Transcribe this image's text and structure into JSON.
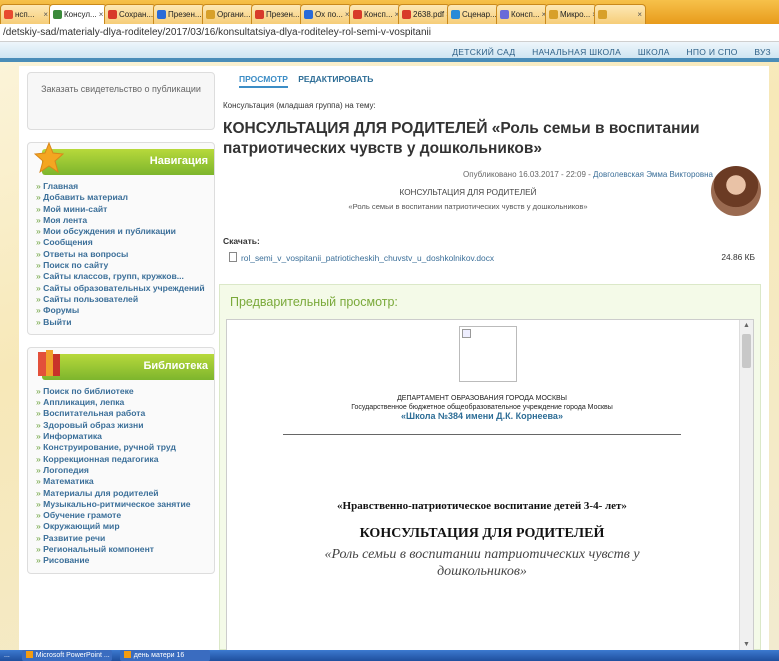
{
  "browser": {
    "tabs": [
      {
        "label": "нсп...",
        "color": "#e84a2f",
        "active": false
      },
      {
        "label": "Консул...",
        "color": "#3a8a3a",
        "active": true
      },
      {
        "label": "Сохран...",
        "color": "#d83a2a",
        "active": false
      },
      {
        "label": "Презен...",
        "color": "#2a6ad8",
        "active": false
      },
      {
        "label": "Органи...",
        "color": "#d8a02a",
        "active": false
      },
      {
        "label": "Презен...",
        "color": "#d83a2a",
        "active": false
      },
      {
        "label": "Ох по...",
        "color": "#2a6ad8",
        "active": false
      },
      {
        "label": "Консп...",
        "color": "#d83a2a",
        "active": false
      },
      {
        "label": "2638.pdf",
        "color": "#d83a2a",
        "active": false
      },
      {
        "label": "Сценар...",
        "color": "#2a8ad8",
        "active": false
      },
      {
        "label": "Консп...",
        "color": "#6a6ad8",
        "active": false
      },
      {
        "label": "Микро...",
        "color": "#d8a02a",
        "active": false
      },
      {
        "label": "",
        "color": "#d8a02a",
        "active": false
      }
    ],
    "address": "/detskiy-sad/materialy-dlya-roditeley/2017/03/16/konsultatsiya-dlya-roditeley-rol-semi-v-vospitanii"
  },
  "topnav": {
    "items": [
      "ДЕТСКИЙ САД",
      "НАЧАЛЬНАЯ ШКОЛА",
      "ШКОЛА",
      "НПО И СПО",
      "ВУЗ"
    ]
  },
  "sidebar": {
    "certificate": "Заказать свидетельство о публикации",
    "navigation": {
      "title": "Навигация",
      "items": [
        "Главная",
        "Добавить материал",
        "Мой мини-сайт",
        "Моя лента",
        "Мои обсуждения и публикации",
        "Сообщения",
        "Ответы на вопросы",
        "Поиск по сайту",
        "Сайты классов, групп, кружков...",
        "Сайты образовательных учреждений",
        "Сайты пользователей",
        "Форумы",
        "Выйти"
      ]
    },
    "library": {
      "title": "Библиотека",
      "items": [
        "Поиск по библиотеке",
        "Аппликация, лепка",
        "Воспитательная работа",
        "Здоровый образ жизни",
        "Информатика",
        "Конструирование, ручной труд",
        "Коррекционная педагогика",
        "Логопедия",
        "Математика",
        "Материалы для родителей",
        "Музыкально-ритмическое занятие",
        "Обучение грамоте",
        "Окружающий мир",
        "Развитие речи",
        "Региональный компонент",
        "Рисование"
      ]
    }
  },
  "main": {
    "actions": {
      "view": "ПРОСМОТР",
      "edit": "РЕДАКТИРОВАТЬ"
    },
    "subtitle": "Консультация (младшая группа) на тему:",
    "title": "КОНСУЛЬТАЦИЯ ДЛЯ РОДИТЕЛЕЙ «Роль семьи в воспитании патриотических чувств у дошкольников»",
    "published_prefix": "Опубликовано 16.03.2017 - 22:09 - ",
    "author": "Довголевская Эмма Викторовна",
    "meta_line1": "КОНСУЛЬТАЦИЯ ДЛЯ РОДИТЕЛЕЙ",
    "meta_line2": "«Роль семьи в воспитании патриотических чувств у дошкольников»",
    "download_label": "Скачать:",
    "file_name": "rol_semi_v_vospitanii_patrioticheskih_chuvstv_u_doshkolnikov.docx",
    "file_size": "24.86 КБ",
    "preview_label": "Предварительный просмотр:"
  },
  "document": {
    "dept": "ДЕПАРТАМЕНТ ОБРАЗОВАНИЯ ГОРОДА МОСКВЫ",
    "org": "Государственное бюджетное общеобразовательное учреждение города Москвы",
    "school": "«Школа №384 имени Д.К. Корнеева»",
    "heading1": "«Нравственно-патриотическое воспитание детей 3-4- лет»",
    "heading2": "КОНСУЛЬТАЦИЯ ДЛЯ РОДИТЕЛЕЙ",
    "heading3": "«Роль семьи в воспитании патриотических чувств у дошкольников»"
  },
  "taskbar": {
    "items": [
      "...",
      "Microsoft PowerPoint ...",
      "день матери 16"
    ]
  },
  "colors": {
    "accent_green": "#7db52d",
    "link_blue": "#3b6f99",
    "nav_blue": "#4a8db8",
    "frame_gold": "#f7e8b8"
  }
}
